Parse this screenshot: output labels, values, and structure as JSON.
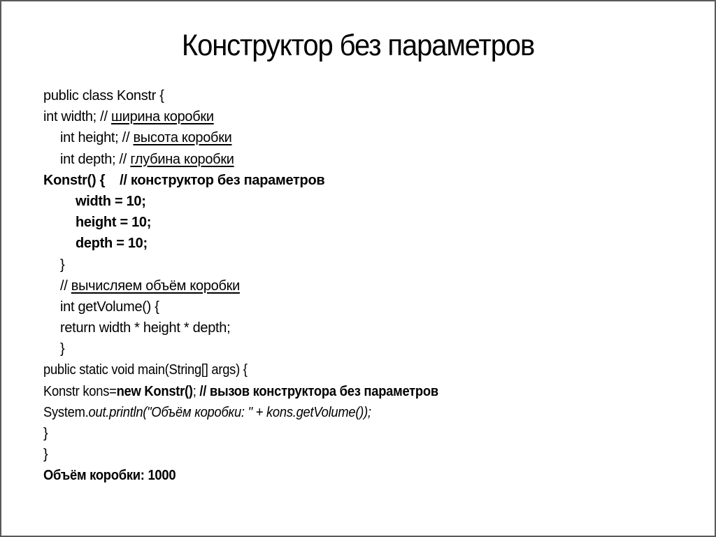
{
  "slide": {
    "title": "Конструктор без параметров",
    "code_lines": [
      {
        "text_a": "public class Konstr {"
      },
      {
        "prefix": "int width; // ",
        "comment": "ширина коробки"
      },
      {
        "prefix": "int height; // ",
        "comment": "высота коробки"
      },
      {
        "prefix": "int depth; // ",
        "comment": "глубина коробки"
      },
      {
        "text_a": "Konstr() {    // конструктор без параметров"
      },
      {
        "text_a": "width = 10;"
      },
      {
        "text_a": "height = 10;"
      },
      {
        "text_a": "depth = 10;"
      },
      {
        "text_a": "}"
      },
      {
        "prefix": "// ",
        "comment": "вычисляем объём коробки"
      },
      {
        "text_a": "int getVolume() {"
      },
      {
        "text_a": "return width * height * depth;"
      },
      {
        "text_a": "}"
      },
      {
        "text_a": "public static void main(String[] args) {"
      },
      {
        "prefix": "Konstr kons=",
        "bold_part": "new Konstr()",
        "mid": ";",
        "bold_comment": " // вызов конструктора без параметров"
      },
      {
        "prefix": "System.",
        "italic_part": "out.println(\"Объём коробки: \" + kons.getVolume());"
      },
      {
        "text_a": "}"
      },
      {
        "text_a": "}"
      },
      {
        "text_a": "Объём коробки: 1000"
      }
    ]
  }
}
